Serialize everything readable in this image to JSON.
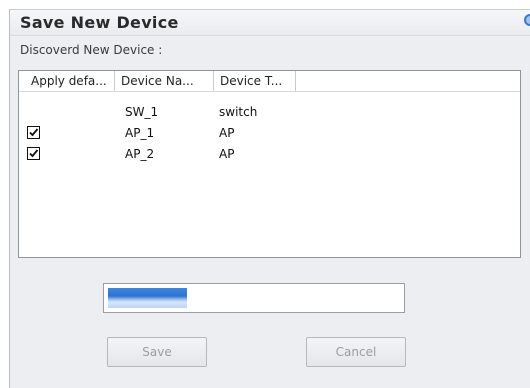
{
  "dialog": {
    "title": "Save New Device",
    "section_label": "Discoverd New Device :"
  },
  "table": {
    "columns": [
      "Apply defa...",
      "Device Na...",
      "Device T..."
    ],
    "rows": [
      {
        "apply_default": null,
        "name": "SW_1",
        "type": "switch"
      },
      {
        "apply_default": true,
        "name": "AP_1",
        "type": "AP"
      },
      {
        "apply_default": true,
        "name": "AP_2",
        "type": "AP"
      }
    ]
  },
  "progress": {
    "fraction": 0.27
  },
  "buttons": {
    "save_label": "Save",
    "cancel_label": "Cancel",
    "enabled": false
  },
  "icons": {
    "title_corner": "info-orb-icon",
    "checkbox": "checkmark-icon"
  },
  "colors": {
    "accent": "#2f72cf",
    "dialog_bg": "#eceef1"
  }
}
